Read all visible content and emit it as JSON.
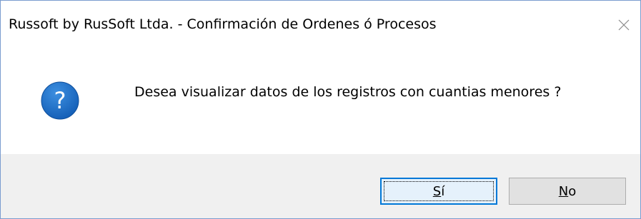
{
  "window": {
    "title": "Russoft by RusSoft Ltda. - Confirmación de Ordenes ó Procesos",
    "close_icon": "close-icon"
  },
  "dialog": {
    "icon": "question-icon",
    "icon_color": "#1f6fc5",
    "message": "Desea visualizar datos de los registros con cuantias menores ?"
  },
  "buttons": {
    "yes": {
      "mnemonic": "S",
      "rest": "í",
      "default": true
    },
    "no": {
      "mnemonic": "N",
      "rest": "o",
      "default": false
    }
  },
  "colors": {
    "focus_border": "#0078d7",
    "button_bar": "#f0f0f0"
  }
}
